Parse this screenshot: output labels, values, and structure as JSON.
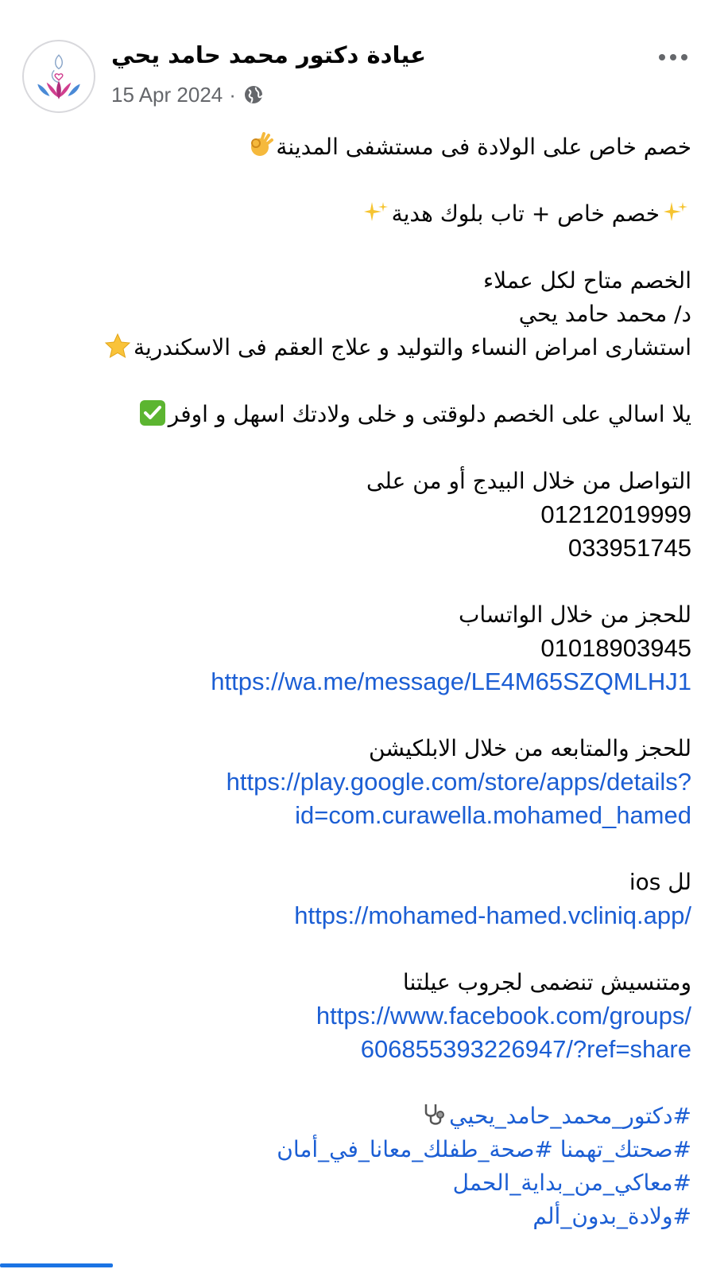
{
  "post": {
    "page_name": "عيادة دكتور محمد حامد يحي",
    "date": "15 Apr 2024",
    "separator": "·",
    "privacy_icon": "globe-icon",
    "more_icon": "more-options-icon",
    "avatar_icon": "lotus-mother-baby-logo-icon"
  },
  "body": {
    "line1": "خصم خاص على الولادة فى مستشفى المدينة",
    "line1_emoji": "ok-hand-emoji",
    "line2": "خصم خاص + تاب بلوك هدية",
    "line2_emoji": "sparkles-emoji",
    "line3": "الخصم متاح لكل عملاء",
    "line4": "د/ محمد حامد يحي",
    "line5": "استشارى امراض النساء والتوليد و علاج العقم فى الاسكندرية",
    "line5_emoji": "star-emoji",
    "line6": "يلا اسالي على الخصم دلوقتى و خلى ولادتك اسهل و اوفر",
    "line6_emoji": "check-mark-emoji",
    "contact_heading": "التواصل من خلال البيدج أو من على",
    "phone1": "01212019999",
    "phone2": "033951745",
    "whatsapp_heading": "للحجز من خلال الواتساب",
    "whatsapp_phone": "01018903945",
    "whatsapp_link": "https://wa.me/message/LE4M65SZQMLHJ1",
    "app_heading": "للحجز والمتابعه من خلال الابلكيشن",
    "play_link_line1": "https://play.google.com/store/apps/details?",
    "play_link_line2": "id=com.curawella.mohamed_hamed",
    "ios_heading": "لل ios",
    "ios_link": "https://mohamed-hamed.vcliniq.app/",
    "group_heading": "ومتنسيش تنضمى لجروب عيلتنا",
    "group_link_line1": "https://www.facebook.com/groups/",
    "group_link_line2": "606855393226947/?ref=share",
    "hashtag1": "#دكتور_محمد_حامد_يحيي",
    "hashtag1_emoji": "stethoscope-emoji",
    "hashtag2": "#صحتك_تهمنا #صحة_طفلك_معانا_في_أمان",
    "hashtag3": "#معاكي_من_بداية_الحمل",
    "hashtag4": "#ولادة_بدون_ألم"
  },
  "colors": {
    "link": "#1b5ed4",
    "meta_text": "#65676b",
    "text": "#050505",
    "check_green": "#5cb531",
    "star_yellow": "#f9c33a"
  }
}
